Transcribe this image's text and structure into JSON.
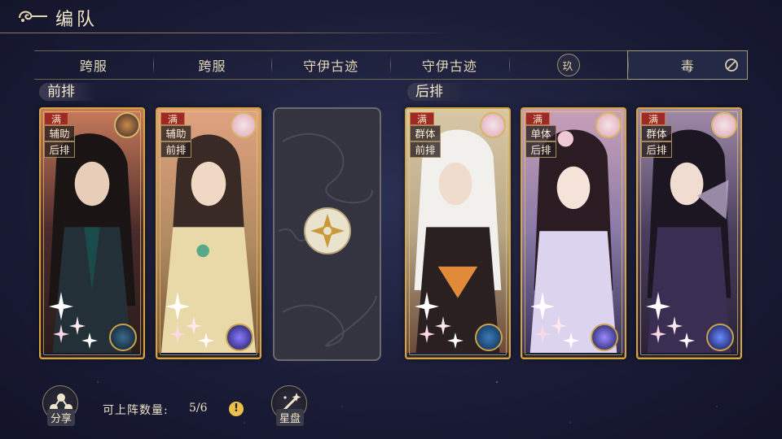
{
  "header": {
    "title": "编队"
  },
  "tabs": [
    {
      "label": "跨服"
    },
    {
      "label": "跨服"
    },
    {
      "label": "守伊古迹"
    },
    {
      "label": "守伊古迹"
    },
    {
      "label": "玖"
    },
    {
      "label": "毒"
    }
  ],
  "front_row": {
    "label": "前排",
    "cards": [
      {
        "level_tag": "满",
        "role": "辅助",
        "position": "后排",
        "palette": "#3a2a2a"
      },
      {
        "level_tag": "满",
        "role": "辅助",
        "position": "前排",
        "palette": "#b98f62"
      }
    ]
  },
  "back_row": {
    "label": "后排",
    "cards": [
      {
        "level_tag": "满",
        "role": "群体",
        "position": "前排",
        "palette": "#c9b99e"
      },
      {
        "level_tag": "满",
        "role": "单体",
        "position": "后排",
        "palette": "#9b8ab5"
      },
      {
        "level_tag": "满",
        "role": "群体",
        "position": "后排",
        "palette": "#574a6e"
      }
    ]
  },
  "footer": {
    "share_label": "分享",
    "deploy_label": "可上阵数量:",
    "deploy_count": "5/6",
    "warn_symbol": "!",
    "astrolabe_label": "星盘"
  },
  "colors": {
    "gold": "#d4a540",
    "background": "#1b1d38",
    "tag_red": "#9d2a26"
  }
}
